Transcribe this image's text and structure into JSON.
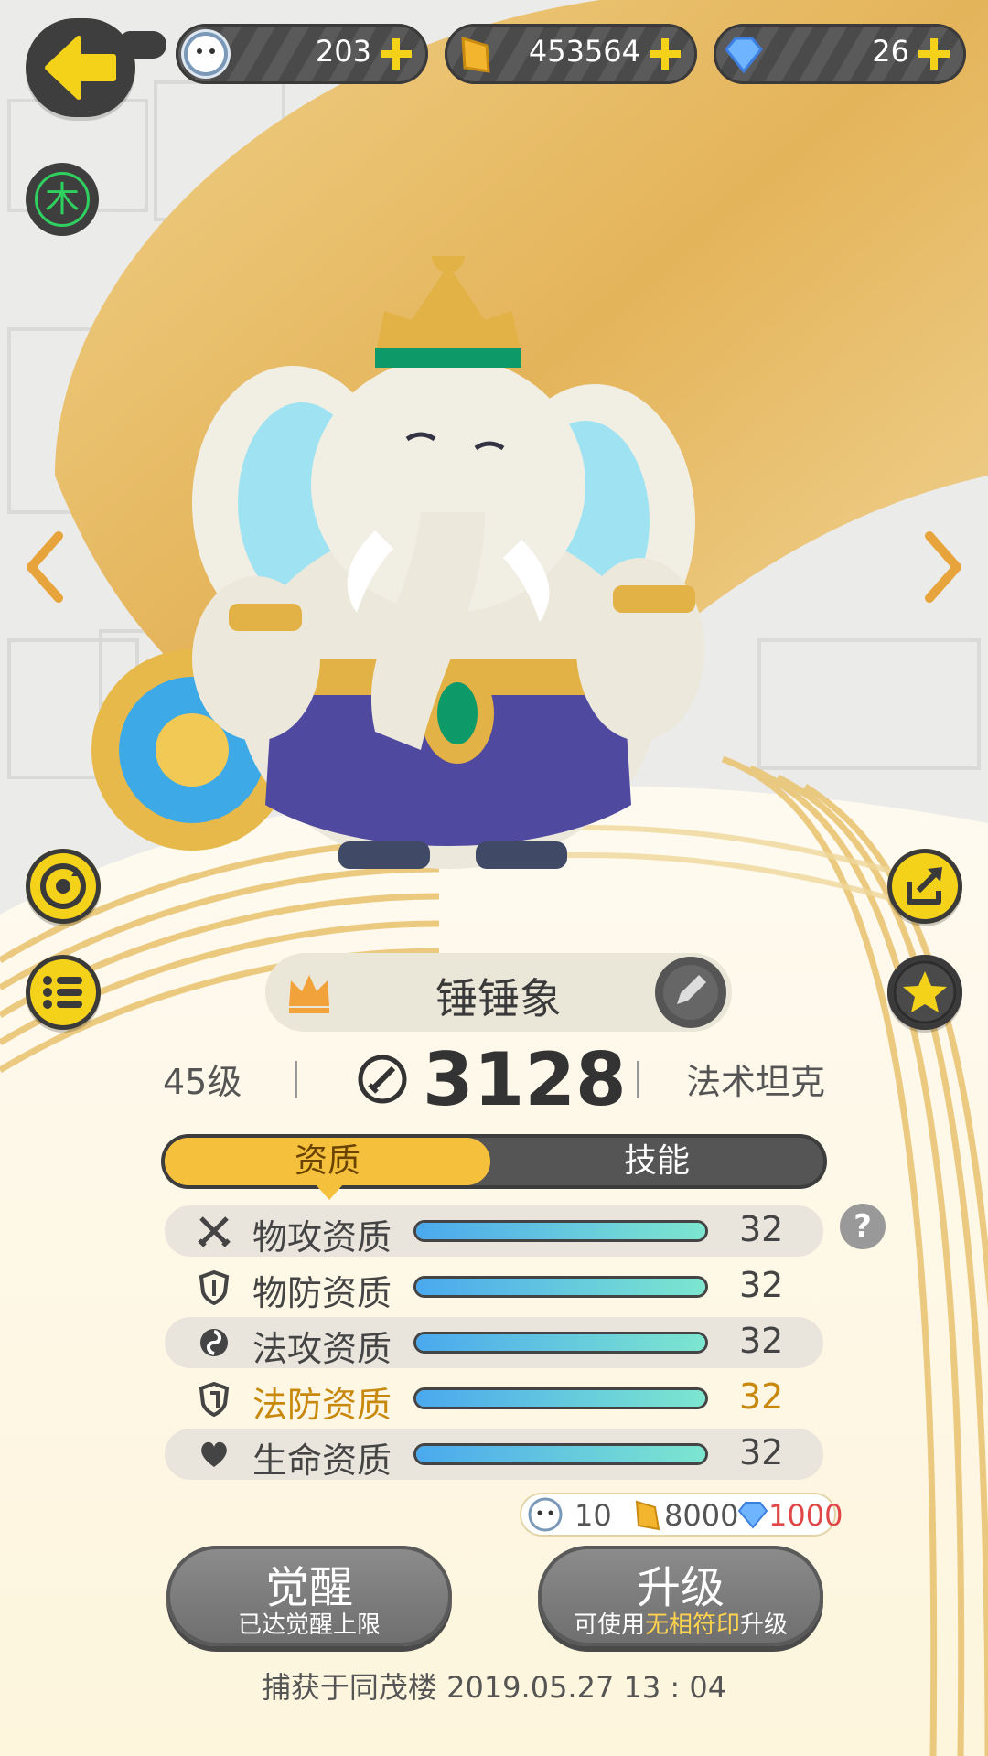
{
  "topbar": {
    "currencies": [
      {
        "icon": "spirit-token-icon",
        "value": "203"
      },
      {
        "icon": "gold-ingot-icon",
        "value": "453564"
      },
      {
        "icon": "diamond-icon",
        "value": "26"
      }
    ]
  },
  "element_badge": "木",
  "pet": {
    "name": "锤锤象",
    "level": "45级",
    "power": "3128",
    "role": "法术坦克"
  },
  "tabs": {
    "active": "资质",
    "inactive": "技能"
  },
  "aptitudes": [
    {
      "label": "物攻资质",
      "value": "32",
      "icon": "crossed-swords-icon",
      "fill": 1.0
    },
    {
      "label": "物防资质",
      "value": "32",
      "icon": "shield-icon",
      "fill": 1.0
    },
    {
      "label": "法攻资质",
      "value": "32",
      "icon": "swirl-icon",
      "fill": 1.0
    },
    {
      "label": "法防资质",
      "value": "32",
      "icon": "magic-shield-icon",
      "fill": 1.0,
      "highlight": "#c7880c"
    },
    {
      "label": "生命资质",
      "value": "32",
      "icon": "heart-icon",
      "fill": 1.0
    }
  ],
  "help_label": "?",
  "cost": {
    "token": "10",
    "gold": "8000",
    "diamond": "1000"
  },
  "buttons": {
    "awaken_title": "觉醒",
    "awaken_sub": "已达觉醒上限",
    "upgrade_title": "升级",
    "upgrade_sub_a": "可使用",
    "upgrade_sub_b": "无相符印",
    "upgrade_sub_c": "升级"
  },
  "captured_text": "捕获于同茂楼  2019.05.27   13 : 04",
  "colors": {
    "accent_yellow": "#f5c03b",
    "button_yellow": "#f5d21a",
    "dark": "#3e3e3e",
    "bar_start": "#4aa9ee",
    "bar_end": "#7de6cf",
    "cost_red": "#e04747"
  }
}
